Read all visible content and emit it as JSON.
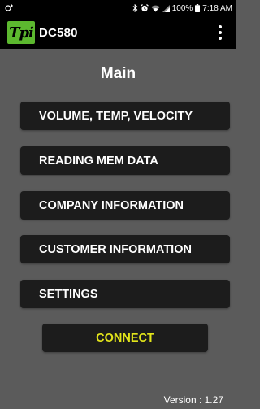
{
  "status_bar": {
    "battery": "100%",
    "time": "7:18 AM",
    "icons": [
      "notification-icon",
      "bluetooth-icon",
      "alarm-icon",
      "wifi-icon",
      "signal-icon",
      "battery-icon"
    ]
  },
  "app_bar": {
    "logo_text": "Tpi",
    "title": "DC580",
    "overflow_icon": "more-vert-icon"
  },
  "main": {
    "title": "Main",
    "menu": [
      {
        "label": "VOLUME, TEMP, VELOCITY"
      },
      {
        "label": "READING MEM DATA"
      },
      {
        "label": "COMPANY INFORMATION"
      },
      {
        "label": "CUSTOMER INFORMATION"
      },
      {
        "label": "SETTINGS"
      }
    ],
    "connect_label": "CONNECT",
    "version": "Version : 1.27"
  },
  "colors": {
    "background": "#5b5b5b",
    "bar": "#000000",
    "button": "#1c1c1c",
    "logo_green": "#5cb82f",
    "connect_text": "#e2e41a"
  }
}
